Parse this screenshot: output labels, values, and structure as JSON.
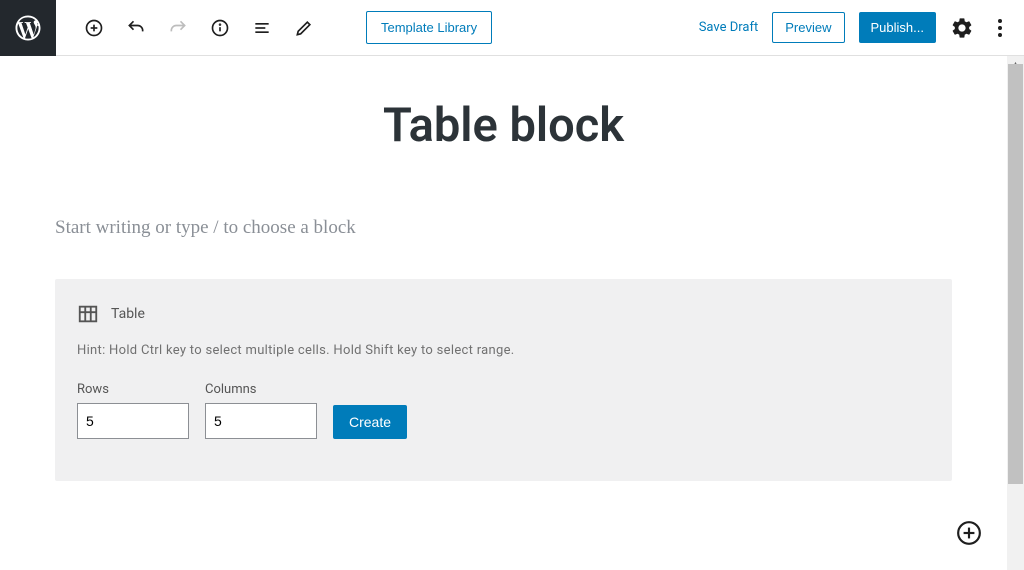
{
  "toolbar": {
    "template_library_label": "Template Library",
    "save_draft_label": "Save Draft",
    "preview_label": "Preview",
    "publish_label": "Publish..."
  },
  "page": {
    "title": "Table block",
    "placeholder": "Start writing or type / to choose a block"
  },
  "table_block": {
    "title": "Table",
    "hint": "Hint: Hold Ctrl key to select multiple cells. Hold Shift key to select range.",
    "rows_label": "Rows",
    "rows_value": "5",
    "columns_label": "Columns",
    "columns_value": "5",
    "create_label": "Create"
  }
}
